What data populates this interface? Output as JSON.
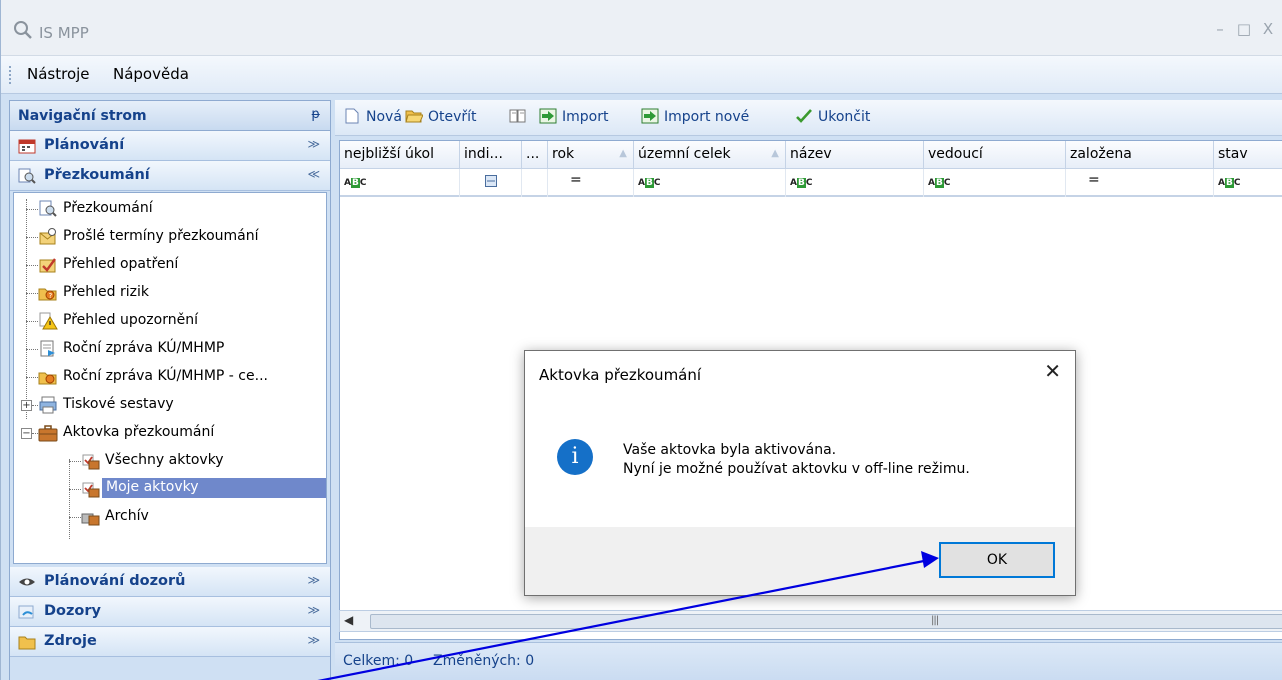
{
  "window": {
    "title": "IS MPP",
    "minimize": "–",
    "maximize": "□",
    "close": "X"
  },
  "menu": {
    "tools": "Nástroje",
    "help": "Nápověda"
  },
  "nav": {
    "header": "Navigační strom",
    "pin": "ᵽ",
    "groups": {
      "planovani": "Plánování",
      "prezkoumani": "Přezkoumání",
      "planovani_dozoru": "Plánování dozorů",
      "dozory": "Dozory",
      "zdroje": "Zdroje"
    },
    "tree": [
      "Přezkoumání",
      "Prošlé termíny přezkoumání",
      "Přehled opatření",
      "Přehled rizik",
      "Přehled upozornění",
      "Roční zpráva KÚ/MHMP",
      "Roční zpráva KÚ/MHMP - ce...",
      "Tiskové sestavy",
      "Aktovka přezkoumání",
      "Všechny aktovky",
      "Moje aktovky",
      "Archív"
    ]
  },
  "toolbar": {
    "new": "Nová",
    "open": "Otevřít",
    "import": "Import",
    "import_new": "Import nové",
    "finish": "Ukončit"
  },
  "grid": {
    "columns": [
      "nejbližší úkol",
      "indi...",
      "...",
      "rok",
      "územní celek",
      "název",
      "vedoucí",
      "založena",
      "stav"
    ],
    "filter_abc": "A B C",
    "filter_eq": "="
  },
  "status": {
    "total": "Celkem: 0",
    "changed": "Změněných: 0"
  },
  "dialog": {
    "title": "Aktovka přezkoumání",
    "close": "✕",
    "icon": "i",
    "line1": "Vaše aktovka byla aktivována.",
    "line2": "Nyní je možné používat aktovku v off-line režimu.",
    "ok": "OK"
  },
  "colors": {
    "accent": "#15428b",
    "selection": "#6f88cb",
    "ok_border": "#0078d7",
    "annotation_arrow": "#0000e0"
  }
}
